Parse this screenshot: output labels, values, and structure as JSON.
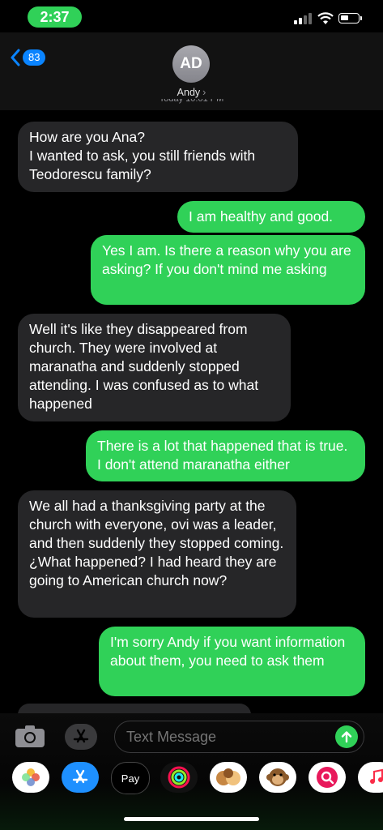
{
  "status": {
    "time": "2:37"
  },
  "header": {
    "back_count": "83",
    "avatar_initials": "AD",
    "contact_name": "Andy",
    "timestamp": "Today 10:01 PM"
  },
  "messages": [
    {
      "dir": "in",
      "text": "How are you Ana?\nI wanted to ask, you still friends with Teodorescu family?"
    },
    {
      "dir": "out",
      "text": "I am healthy and good."
    },
    {
      "dir": "out",
      "text": "Yes I am. Is there a reason why you are asking? If you don't mind me asking"
    },
    {
      "dir": "in",
      "text": "Well it's like they disappeared from church. They were involved at maranatha and suddenly stopped attending. I was confused as to what happened"
    },
    {
      "dir": "out",
      "text": "There is a lot that happened that is true. I don't attend maranatha either"
    },
    {
      "dir": "in",
      "text": "We all had a thanksgiving party at the church with everyone, ovi was a leader, and then suddenly they stopped coming. ¿What happened? I had heard they are going to American church now?"
    },
    {
      "dir": "out",
      "text": "I'm sorry Andy if you want information about them, you need to ask them"
    }
  ],
  "compose": {
    "placeholder": "Text Message"
  },
  "app_drawer": [
    {
      "name": "photos-app-icon"
    },
    {
      "name": "app-store-icon"
    },
    {
      "name": "apple-pay-icon",
      "label": "Pay"
    },
    {
      "name": "activity-icon"
    },
    {
      "name": "memoji-icon"
    },
    {
      "name": "animoji-monkey-icon"
    },
    {
      "name": "search-images-icon"
    },
    {
      "name": "music-icon"
    }
  ],
  "colors": {
    "outgoing": "#30d158",
    "incoming": "#262628",
    "accent": "#0a84ff"
  }
}
